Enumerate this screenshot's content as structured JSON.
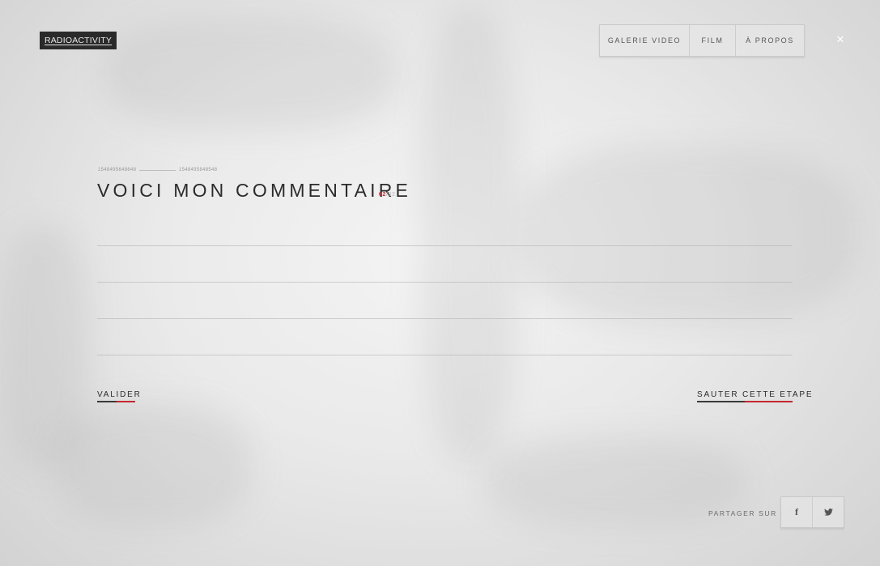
{
  "logo": {
    "text": "RADIOACTIVITY"
  },
  "nav": {
    "items": [
      {
        "label": "GALERIE VIDEO"
      },
      {
        "label": "FILM"
      },
      {
        "label": "À PROPOS"
      }
    ],
    "close_icon": "close-icon",
    "close_glyph": "✕"
  },
  "meta": {
    "left_code": "1548495648648",
    "right_code": "1548495848548"
  },
  "heading": {
    "title": "VOICI MON COMMENTAIRE",
    "step_current": "02",
    "step_separator": "/",
    "step_total": "02"
  },
  "actions": {
    "validate": "VALIDER",
    "skip": "SAUTER CETTE ETAPE"
  },
  "share": {
    "label": "PARTAGER SUR :",
    "facebook_glyph": "f",
    "twitter_glyph": "t"
  },
  "colors": {
    "accent": "#c5282f",
    "text": "#2b2b2b"
  }
}
